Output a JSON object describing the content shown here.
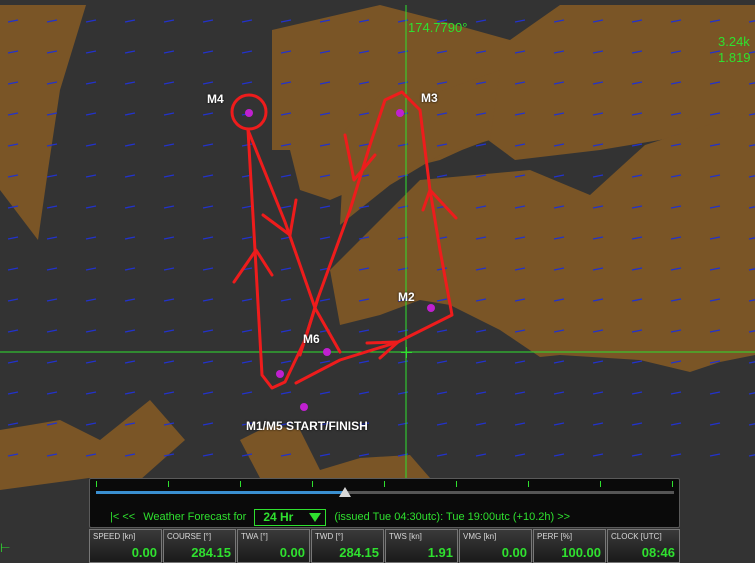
{
  "map": {
    "longitude_readout": "174.7790°",
    "distance_readout_1": "3.24k",
    "distance_readout_2": "1.819",
    "land_color": "#7a5526",
    "water_color": "#333333",
    "course_color": "#ee1c1c",
    "mark_color": "#c020d0",
    "crosshair_color": "#2fe02f",
    "wind_arrow_color": "#2233cc"
  },
  "marks": {
    "m1": "M1/M5 START/FINISH",
    "m2": "M2",
    "m3": "M3",
    "m4": "M4",
    "m6": "M6"
  },
  "timeline": {
    "nav_back": "|<  <<",
    "forecast_prefix": "Weather Forecast for",
    "duration_value": "24 Hr",
    "issued_text": "(issued Tue 04:30utc): Tue 19:00utc  (+10.2h)  >>",
    "progress": 0.43
  },
  "instruments": [
    {
      "label": "SPEED [kn]",
      "value": "0.00"
    },
    {
      "label": "COURSE [°]",
      "value": "284.15"
    },
    {
      "label": "TWA [°]",
      "value": "0.00"
    },
    {
      "label": "TWD [°]",
      "value": "284.15"
    },
    {
      "label": "TWS [kn]",
      "value": "1.91"
    },
    {
      "label": "VMG [kn]",
      "value": "0.00"
    },
    {
      "label": "PERF [%]",
      "value": "100.00"
    },
    {
      "label": "CLOCK [UTC]",
      "value": "08:46"
    }
  ]
}
